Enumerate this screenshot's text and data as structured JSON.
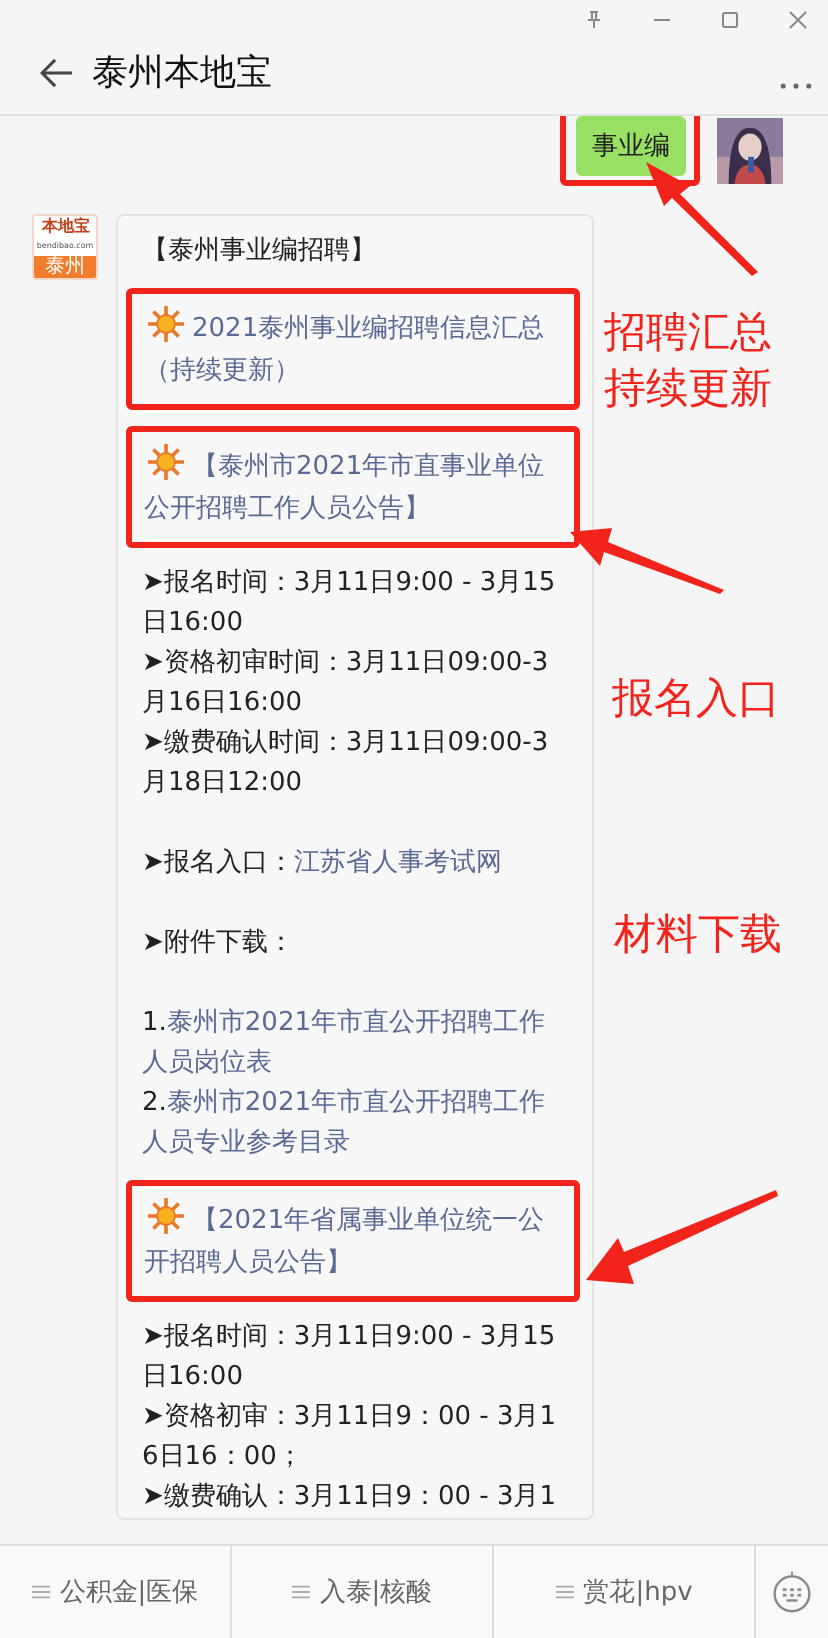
{
  "window": {
    "title": "泰州本地宝"
  },
  "sent": {
    "text": "事业编",
    "highlighted": true
  },
  "logo": {
    "brand": "本地宝",
    "site": "bendibao.com",
    "city": "泰州"
  },
  "blocks": [
    {
      "kind": "heading",
      "text": "【泰州事业编招聘】"
    },
    {
      "kind": "feature",
      "highlighted": true,
      "text": "2021泰州事业编招聘信息汇总（持续更新）"
    },
    {
      "kind": "feature",
      "highlighted": true,
      "text": "【泰州市2021年市直事业单位公开招聘工作人员公告】"
    },
    {
      "kind": "line",
      "text": "➤报名时间：3月11日9:00 - 3月15日16:00"
    },
    {
      "kind": "line",
      "text": "➤资格初审时间：3月11日09:00-3月16日16:00"
    },
    {
      "kind": "line",
      "text": "➤缴费确认时间：3月11日09:00-3月18日12:00"
    },
    {
      "kind": "gap"
    },
    {
      "kind": "line",
      "text": "➤报名入口：",
      "link": "江苏省人事考试网"
    },
    {
      "kind": "gap"
    },
    {
      "kind": "line",
      "text": "➤附件下载："
    },
    {
      "kind": "gap"
    },
    {
      "kind": "line",
      "text": "1.",
      "link": "泰州市2021年市直公开招聘工作人员岗位表"
    },
    {
      "kind": "line",
      "text": "2.",
      "link": "泰州市2021年市直公开招聘工作人员专业参考目录"
    },
    {
      "kind": "feature",
      "highlighted": true,
      "text": "【2021年省属事业单位统一公开招聘人员公告】"
    },
    {
      "kind": "line",
      "text": "➤报名时间：3月11日9:00 - 3月15日16:00"
    },
    {
      "kind": "line",
      "text": "➤资格初审：3月11日9：00 - 3月16日16：00；"
    },
    {
      "kind": "line",
      "text": "➤缴费确认：3月11日9：00 - 3月1"
    }
  ],
  "annotations": [
    {
      "text": "招聘汇总持续更新"
    },
    {
      "text": "报名入口"
    },
    {
      "text": "材料下载"
    }
  ],
  "menu": [
    {
      "label": "公积金|医保"
    },
    {
      "label": "入泰|核酸"
    },
    {
      "label": "赏花|hpv"
    }
  ]
}
